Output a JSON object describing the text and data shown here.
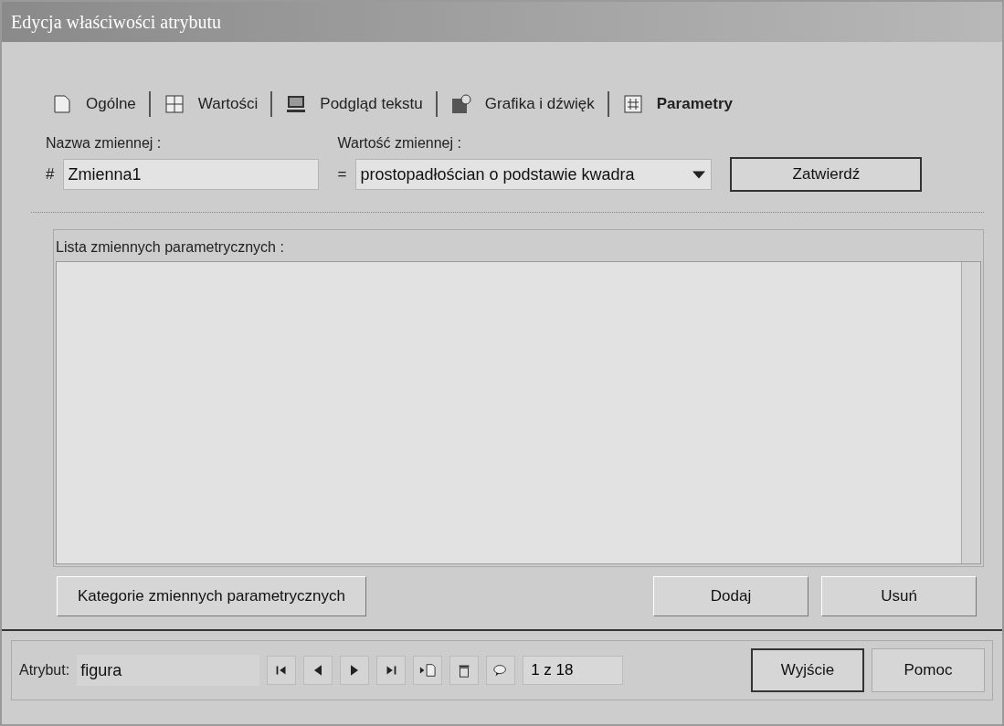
{
  "window": {
    "title": "Edycja właściwości atrybutu"
  },
  "tabs": [
    {
      "label": "Ogólne",
      "selected": false
    },
    {
      "label": "Wartości",
      "selected": false
    },
    {
      "label": "Podgląd tekstu",
      "selected": false
    },
    {
      "label": "Grafika i dźwięk",
      "selected": false
    },
    {
      "label": "Parametry",
      "selected": true
    }
  ],
  "name_field": {
    "label": "Nazwa zmiennej :",
    "prefix": "#",
    "value": "Zmienna1"
  },
  "value_field": {
    "label": "Wartość zmiennej :",
    "prefix": "=",
    "value": "prostopadłościan o podstawie kwadra"
  },
  "confirm_button": "Zatwierdź",
  "list": {
    "label": "Lista zmiennych parametrycznych :"
  },
  "buttons": [
    {
      "label": "Kategorie zmiennych parametrycznych",
      "kind": "left"
    },
    {
      "label": "Dodaj",
      "kind": "right"
    },
    {
      "label": "Usuń",
      "kind": "right"
    }
  ],
  "footer": {
    "label": "Atrybut:",
    "value": "figura",
    "counter": "1 z 18",
    "buttons": [
      {
        "label": "Wyjście",
        "kind": "default"
      },
      {
        "label": "Pomoc",
        "kind": "plain"
      }
    ]
  }
}
